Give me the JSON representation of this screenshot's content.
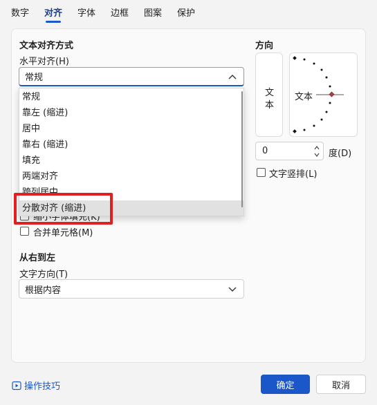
{
  "tabs": [
    "数字",
    "对齐",
    "字体",
    "边框",
    "图案",
    "保护"
  ],
  "active_tab": "对齐",
  "text_alignment": {
    "section_title": "文本对齐方式",
    "horizontal_label": "水平对齐(H)",
    "horizontal_value": "常规",
    "horizontal_options": [
      "常规",
      "靠左 (缩进)",
      "居中",
      "靠右 (缩进)",
      "填充",
      "两端对齐",
      "跨列居中",
      "分散对齐 (缩进)"
    ],
    "highlighted_option": "分散对齐 (缩进)"
  },
  "text_control": {
    "shrink_to_fit_label": "缩小字体填充(K)",
    "merge_cells_label": "合并单元格(M)"
  },
  "rtl": {
    "section_title": "从右到左",
    "direction_label": "文字方向(T)",
    "direction_value": "根据内容"
  },
  "orientation": {
    "section_title": "方向",
    "vertical_text": [
      "文",
      "本"
    ],
    "dial_text": "文本",
    "degree_value": "0",
    "degree_unit": "度(D)",
    "vertical_stack_label": "文字竖排(L)"
  },
  "footer": {
    "tips_link": "操作技巧",
    "ok_label": "确定",
    "cancel_label": "取消"
  },
  "colors": {
    "accent": "#1b57c8",
    "highlight_box": "#e0201f"
  }
}
